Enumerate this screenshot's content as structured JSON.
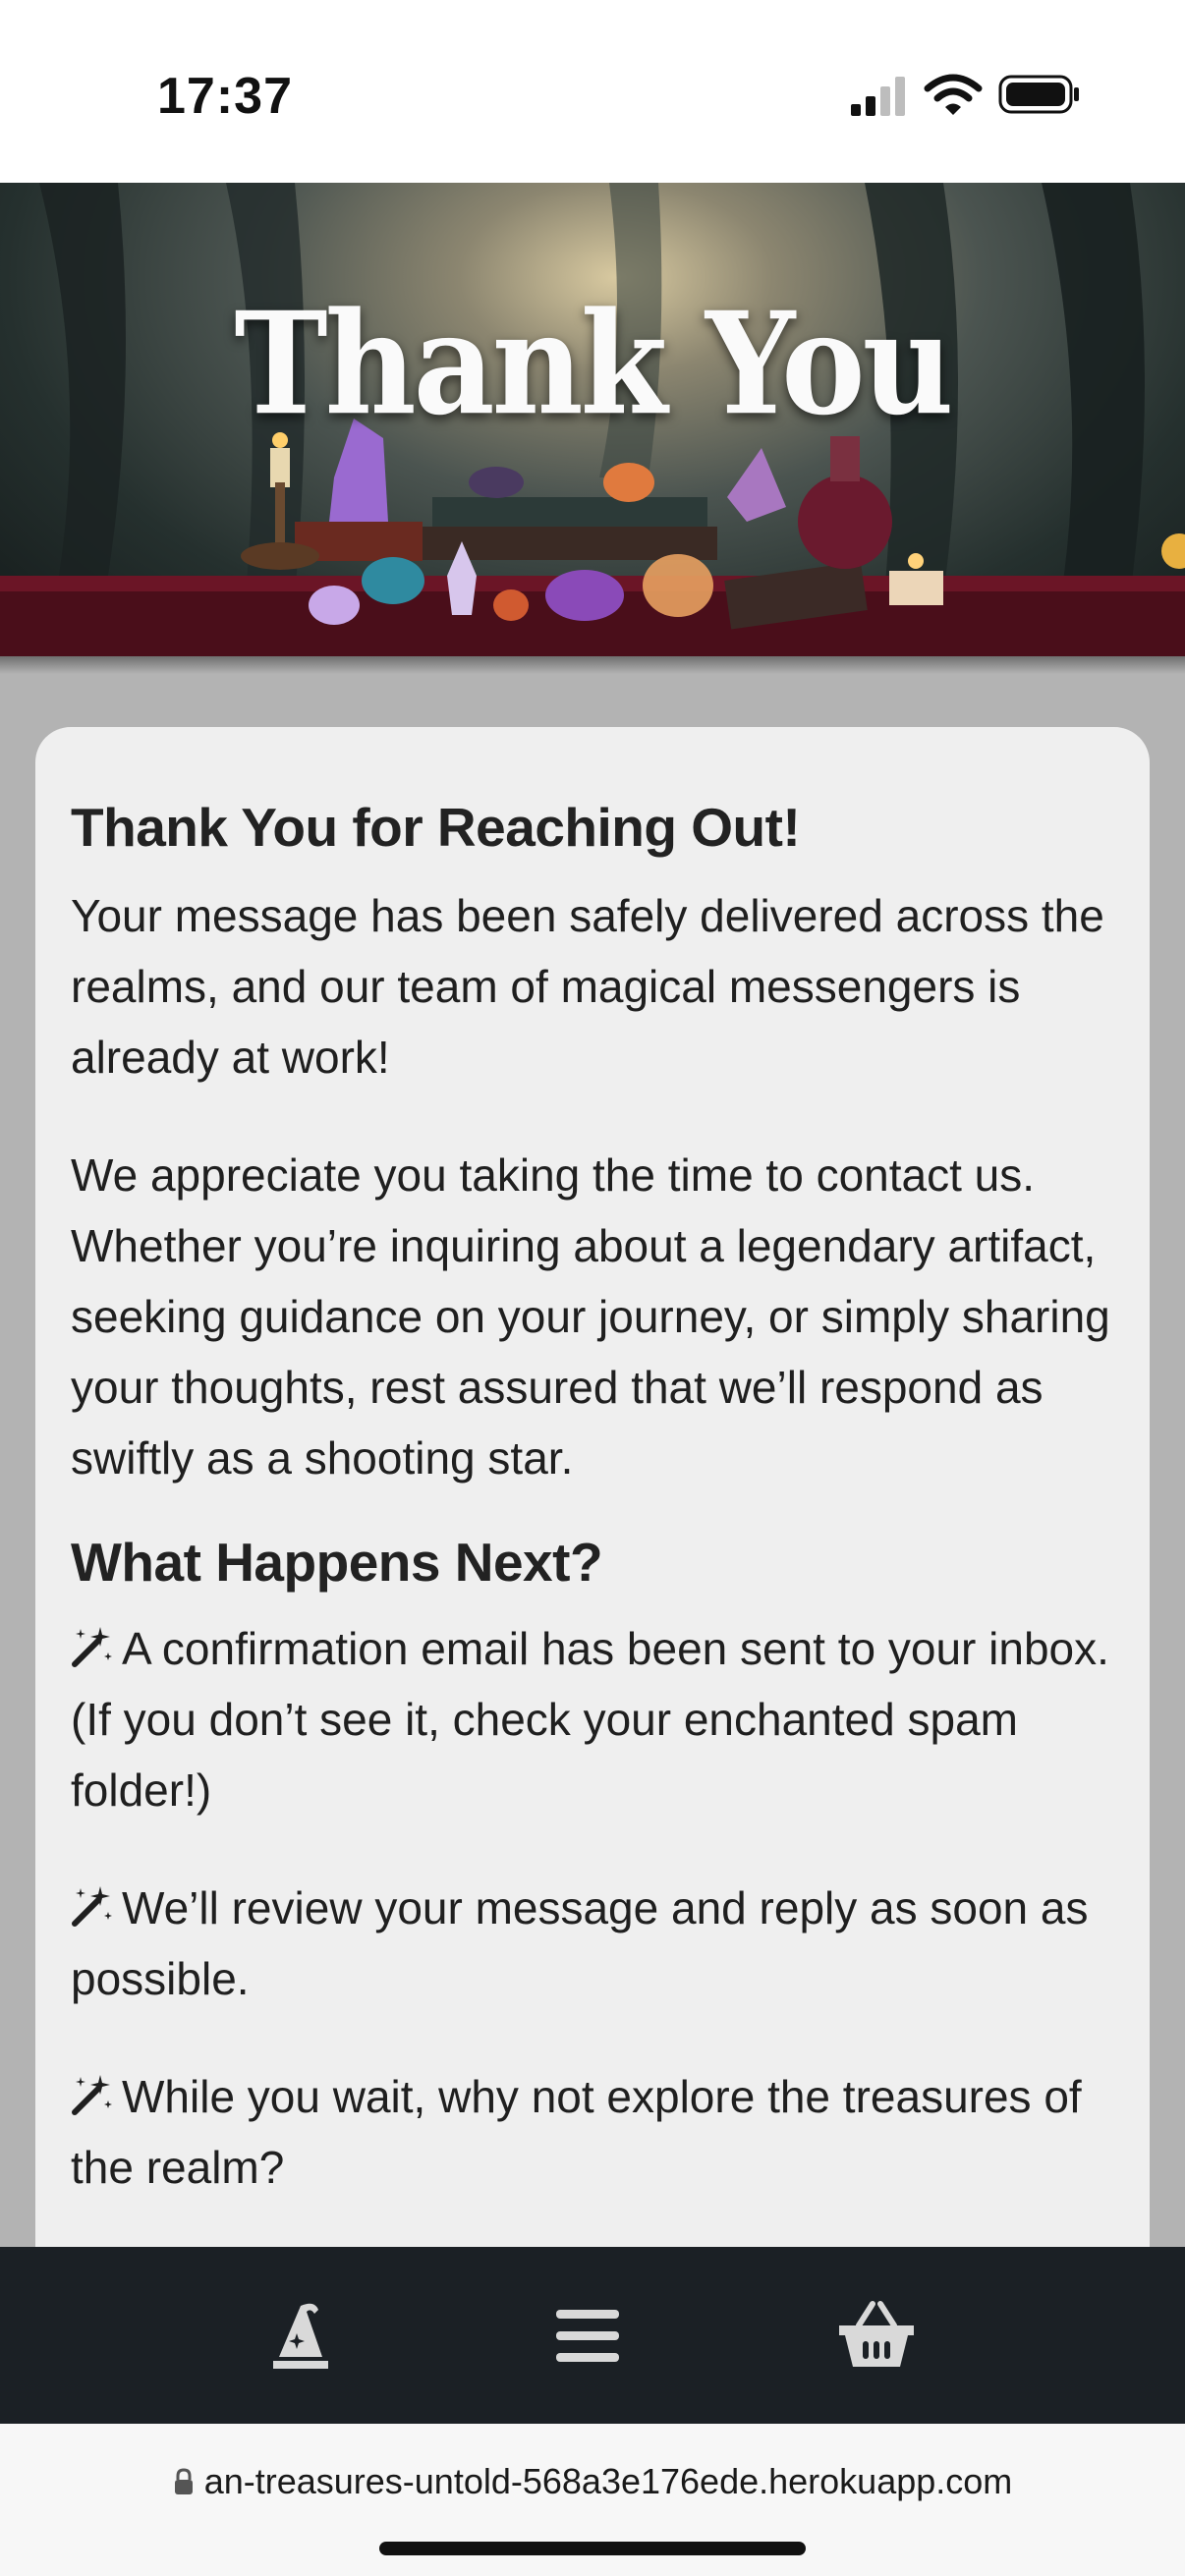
{
  "status_bar": {
    "time": "17:37",
    "signal_icon": "cellular-signal-icon",
    "wifi_icon": "wifi-icon",
    "battery_icon": "battery-icon"
  },
  "hero": {
    "title": "Thank You"
  },
  "content": {
    "heading": "Thank You for Reaching Out!",
    "paragraphs": [
      "Your message has been safely delivered across the realms, and our team of magical messengers is already at work!",
      "We appreciate you taking the time to contact us. Whether you’re inquiring about a legendary artifact, seeking guidance on your journey, or simply sharing your thoughts, rest assured that we’ll respond as swiftly as a shooting star."
    ],
    "next_heading": "What Happens Next?",
    "next_items": [
      "A confirmation email has been sent to your inbox. (If you don’t see it, check your enchanted spam folder!)",
      "We’ll review your message and reply as soon as possible.",
      "While you wait, why not explore the treasures of the realm?"
    ],
    "item_icon": "magic-wand-icon"
  },
  "bottom_nav": {
    "items": [
      {
        "icon": "wizard-hat-icon"
      },
      {
        "icon": "menu-icon"
      },
      {
        "icon": "basket-icon"
      }
    ]
  },
  "url_bar": {
    "url": "an-treasures-untold-568a3e176ede.herokuapp.com",
    "lock_icon": "lock-icon"
  },
  "colors": {
    "page_background": "#b3b3b3",
    "card_background": "#efefef",
    "nav_background": "#1b2025",
    "nav_icon": "#d9d9d9"
  }
}
